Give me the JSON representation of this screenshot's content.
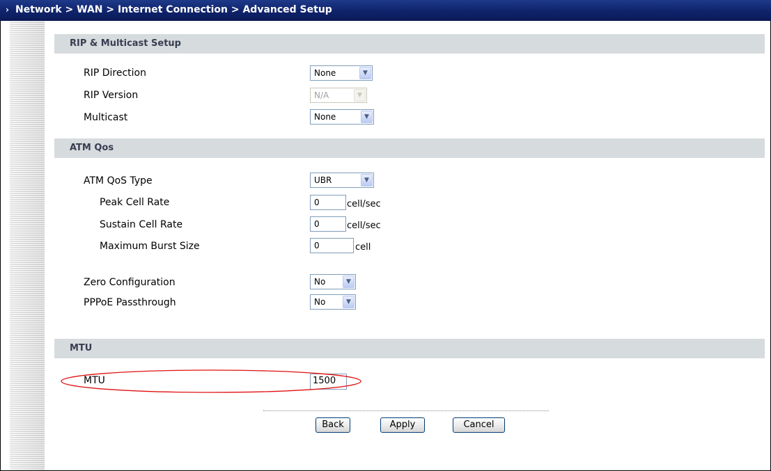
{
  "breadcrumb": "Network > WAN > Internet Connection > Advanced Setup",
  "sections": {
    "rip": {
      "title": "RIP & Multicast Setup",
      "rip_direction_label": "RIP Direction",
      "rip_direction_value": "None",
      "rip_version_label": "RIP Version",
      "rip_version_value": "N/A",
      "multicast_label": "Multicast",
      "multicast_value": "None"
    },
    "atm": {
      "title": "ATM Qos",
      "qos_type_label": "ATM QoS Type",
      "qos_type_value": "UBR",
      "peak_label": "Peak Cell Rate",
      "peak_value": "0",
      "peak_unit": "cell/sec",
      "sustain_label": "Sustain Cell Rate",
      "sustain_value": "0",
      "sustain_unit": "cell/sec",
      "burst_label": "Maximum Burst Size",
      "burst_value": "0",
      "burst_unit": "cell",
      "zero_conf_label": "Zero Configuration",
      "zero_conf_value": "No",
      "pppoe_label": "PPPoE Passthrough",
      "pppoe_value": "No"
    },
    "mtu": {
      "title": "MTU",
      "mtu_label": "MTU",
      "mtu_value": "1500"
    }
  },
  "buttons": {
    "back": "Back",
    "apply": "Apply",
    "cancel": "Cancel"
  },
  "colors": {
    "title_bar": "#10246c",
    "section_header": "#d6dbde",
    "highlight_ellipse": "#e01010"
  },
  "icons": {
    "breadcrumb_arrow": "double-arrow-icon",
    "dropdown": "chevron-down-icon"
  }
}
